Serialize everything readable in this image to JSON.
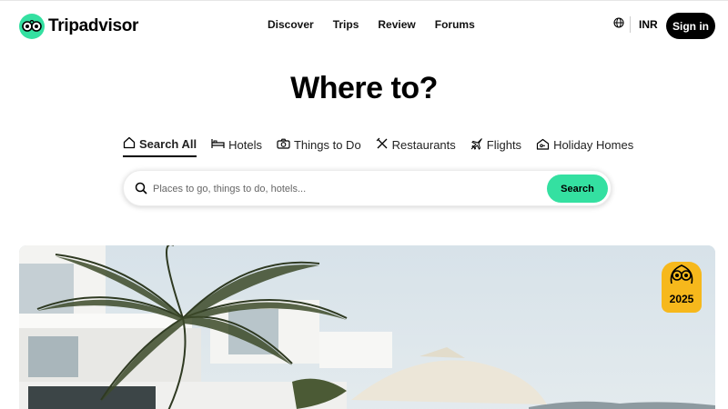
{
  "header": {
    "brand": "Tripadvisor",
    "nav": [
      "Discover",
      "Trips",
      "Review",
      "Forums"
    ],
    "currency": "INR",
    "signin": "Sign in"
  },
  "hero": {
    "title": "Where to?",
    "tabs": [
      {
        "label": "Search All",
        "icon": "home-icon",
        "active": true
      },
      {
        "label": "Hotels",
        "icon": "bed-icon"
      },
      {
        "label": "Things to Do",
        "icon": "camera-icon"
      },
      {
        "label": "Restaurants",
        "icon": "utensils-icon"
      },
      {
        "label": "Flights",
        "icon": "plane-icon"
      },
      {
        "label": "Holiday Homes",
        "icon": "house-key-icon"
      }
    ],
    "search": {
      "placeholder": "Places to go, things to do, hotels...",
      "button": "Search"
    },
    "award": {
      "year": "2025"
    }
  },
  "colors": {
    "brand_green": "#34e0a1",
    "award_yellow": "#f6b81c",
    "dark": "#000000"
  }
}
